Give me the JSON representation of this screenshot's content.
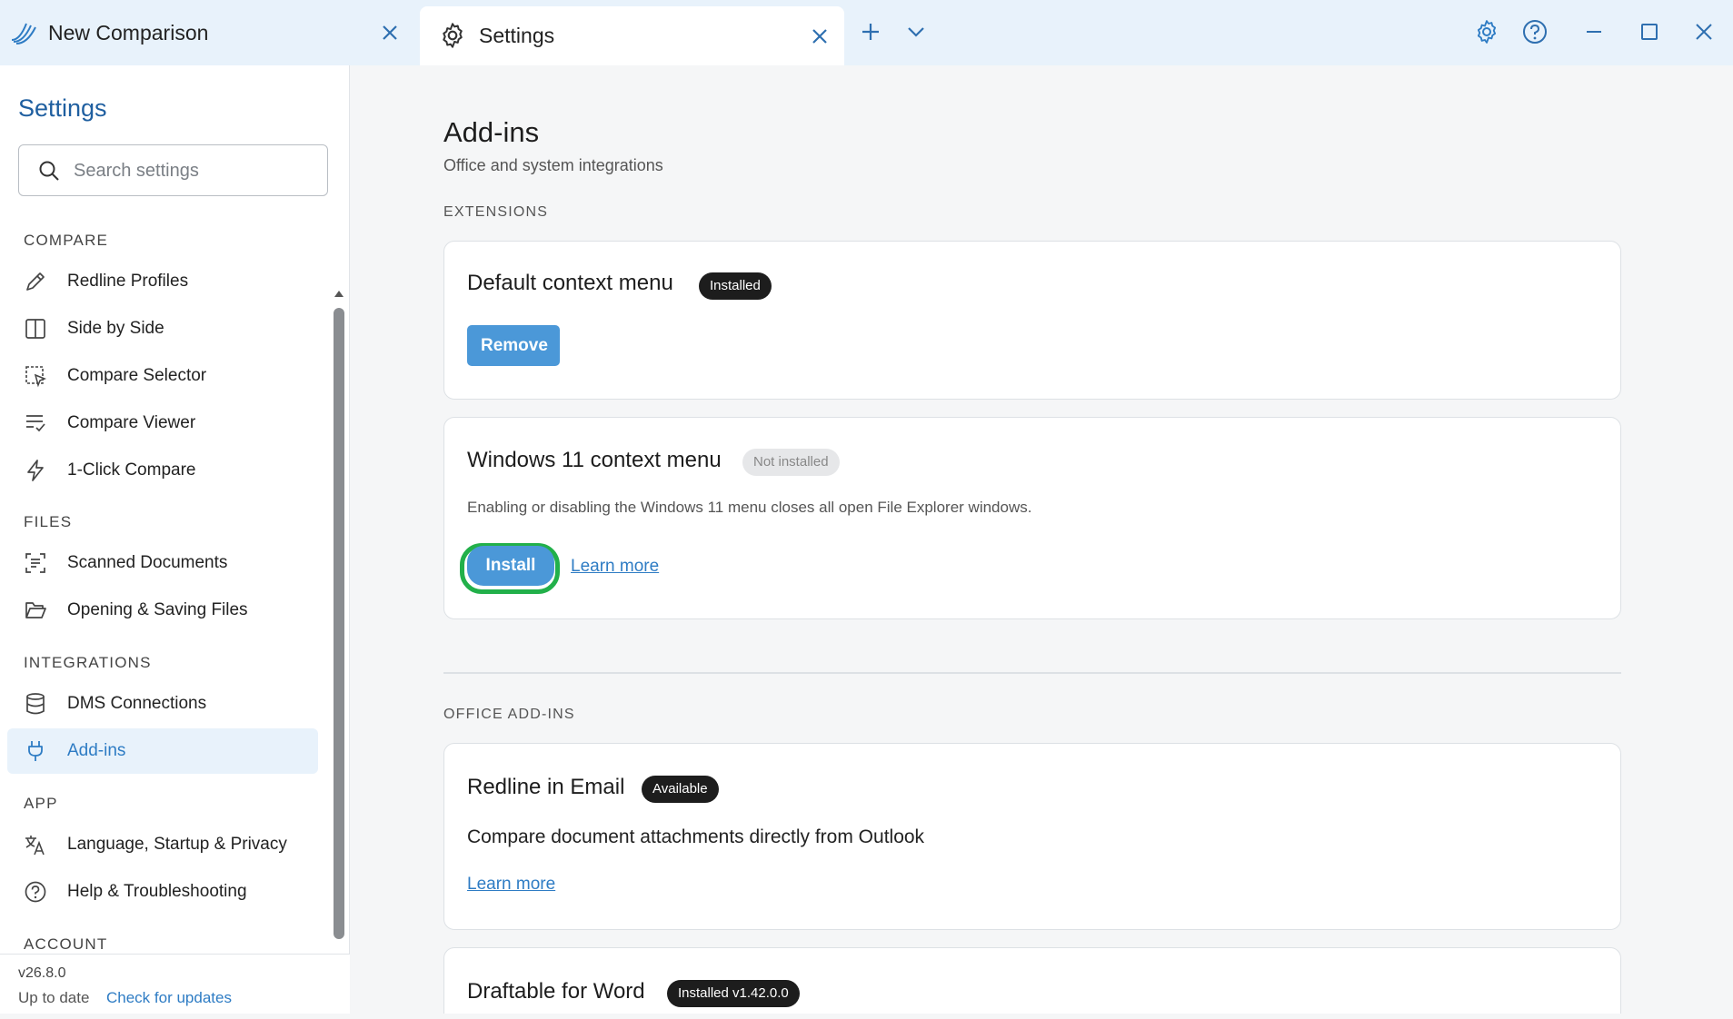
{
  "tabs": [
    {
      "title": "New Comparison",
      "icon": "draftable-logo-icon"
    },
    {
      "title": "Settings",
      "icon": "gear-icon"
    }
  ],
  "sidebar": {
    "title": "Settings",
    "search_placeholder": "Search settings",
    "sections": {
      "compare": "COMPARE",
      "files": "FILES",
      "integrations": "INTEGRATIONS",
      "app": "APP",
      "account": "ACCOUNT"
    },
    "items": {
      "redline_profiles": "Redline Profiles",
      "side_by_side": "Side by Side",
      "compare_selector": "Compare Selector",
      "compare_viewer": "Compare Viewer",
      "one_click": "1-Click Compare",
      "scanned_docs": "Scanned Documents",
      "opening_saving": "Opening & Saving Files",
      "dms": "DMS Connections",
      "addins": "Add-ins",
      "language": "Language, Startup & Privacy",
      "help": "Help & Troubleshooting"
    },
    "footer": {
      "version": "v26.8.0",
      "status": "Up to date",
      "check_updates": "Check for updates"
    }
  },
  "main": {
    "title": "Add-ins",
    "subtitle": "Office and system integrations",
    "extensions_heading": "EXTENSIONS",
    "office_heading": "OFFICE ADD-INS",
    "cards": {
      "default_menu": {
        "title": "Default context menu",
        "badge": "Installed",
        "button": "Remove"
      },
      "win11_menu": {
        "title": "Windows 11 context menu",
        "badge": "Not installed",
        "desc": "Enabling or disabling the Windows 11 menu closes all open File Explorer windows.",
        "button": "Install",
        "link": "Learn more"
      },
      "email": {
        "title": "Redline in Email",
        "badge": "Available",
        "desc": "Compare document attachments directly from Outlook",
        "link": "Learn more"
      },
      "word": {
        "title": "Draftable for Word",
        "badge": "Installed v1.42.0.0"
      }
    }
  },
  "colors": {
    "accent": "#2e7cc4",
    "button": "#4b98d8",
    "highlight_ring": "#22b04a",
    "tabbar": "#e8f2fb"
  }
}
